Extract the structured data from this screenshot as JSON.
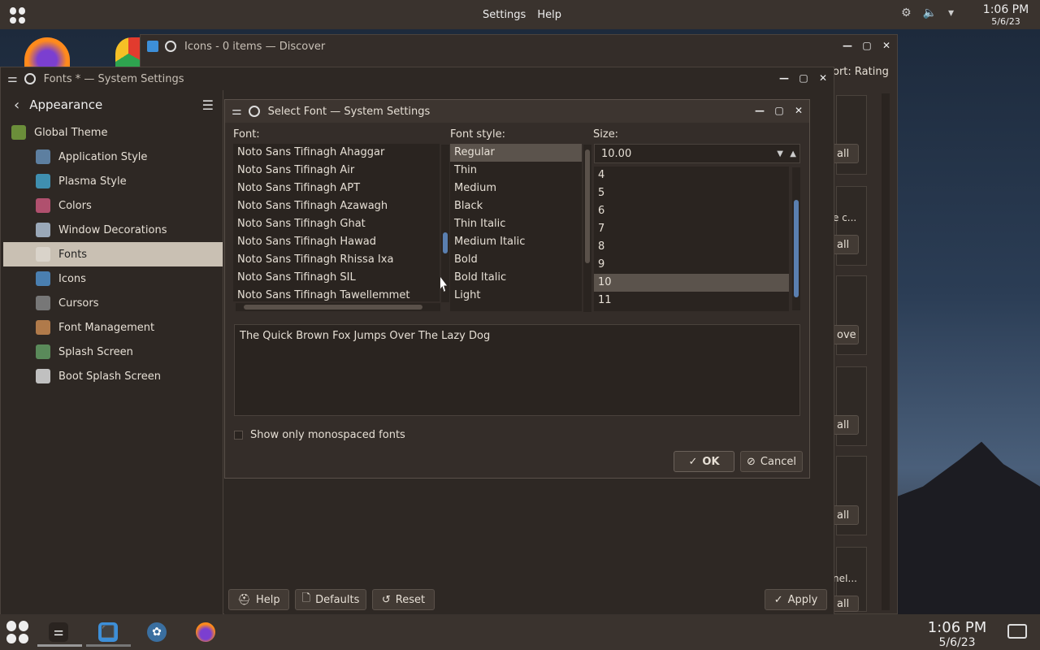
{
  "topbar": {
    "menu_settings": "Settings",
    "menu_help": "Help",
    "time": "1:06 PM",
    "date": "5/6/23"
  },
  "discover": {
    "title": "Icons - 0 items — Discover",
    "sort": "ort: Rating",
    "btns": [
      "all",
      "all",
      "ove",
      "all",
      "all",
      "all"
    ],
    "snippets": [
      "e c...",
      "neI..."
    ]
  },
  "settings": {
    "title": "Fonts * — System Settings",
    "back_label": "Appearance",
    "items": [
      {
        "label": "Global Theme",
        "icon": "global-theme-icon",
        "color": "#6b8e3a"
      },
      {
        "label": "Application Style",
        "icon": "application-style-icon",
        "color": "#5d7fa0"
      },
      {
        "label": "Plasma Style",
        "icon": "plasma-style-icon",
        "color": "#3f8fb0"
      },
      {
        "label": "Colors",
        "icon": "colors-icon",
        "color": "#b0506e"
      },
      {
        "label": "Window Decorations",
        "icon": "window-decorations-icon",
        "color": "#9aa8b8"
      },
      {
        "label": "Fonts",
        "icon": "fonts-icon",
        "color": "#d9d3ca"
      },
      {
        "label": "Icons",
        "icon": "icons-icon",
        "color": "#4a7fb0"
      },
      {
        "label": "Cursors",
        "icon": "cursors-icon",
        "color": "#777"
      },
      {
        "label": "Font Management",
        "icon": "font-management-icon",
        "color": "#b07a4a"
      },
      {
        "label": "Splash Screen",
        "icon": "splash-screen-icon",
        "color": "#5a8a5a"
      },
      {
        "label": "Boot Splash Screen",
        "icon": "boot-splash-screen-icon",
        "color": "#c0c0c0"
      }
    ],
    "help": "Help",
    "defaults": "Defaults",
    "reset": "Reset",
    "apply": "Apply"
  },
  "dialog": {
    "title": "Select Font — System Settings",
    "font_label": "Font:",
    "style_label": "Font style:",
    "size_label": "Size:",
    "fonts": [
      "Noto Sans Tifinagh Ahaggar",
      "Noto Sans Tifinagh Air",
      "Noto Sans Tifinagh APT",
      "Noto Sans Tifinagh Azawagh",
      "Noto Sans Tifinagh Ghat",
      "Noto Sans Tifinagh Hawad",
      "Noto Sans Tifinagh Rhissa Ixa",
      "Noto Sans Tifinagh SIL",
      "Noto Sans Tifinagh Tawellemmet"
    ],
    "styles": [
      "Regular",
      "Thin",
      "Medium",
      "Black",
      "Thin Italic",
      "Medium Italic",
      "Bold",
      "Bold Italic",
      "Light"
    ],
    "size_value": "10.00",
    "sizes": [
      "4",
      "5",
      "6",
      "7",
      "8",
      "9",
      "10",
      "11"
    ],
    "preview": "The Quick Brown Fox Jumps Over The Lazy Dog",
    "mono": "Show only monospaced fonts",
    "ok": "OK",
    "cancel": "Cancel"
  },
  "taskbar": {
    "time": "1:06 PM",
    "date": "5/6/23"
  }
}
